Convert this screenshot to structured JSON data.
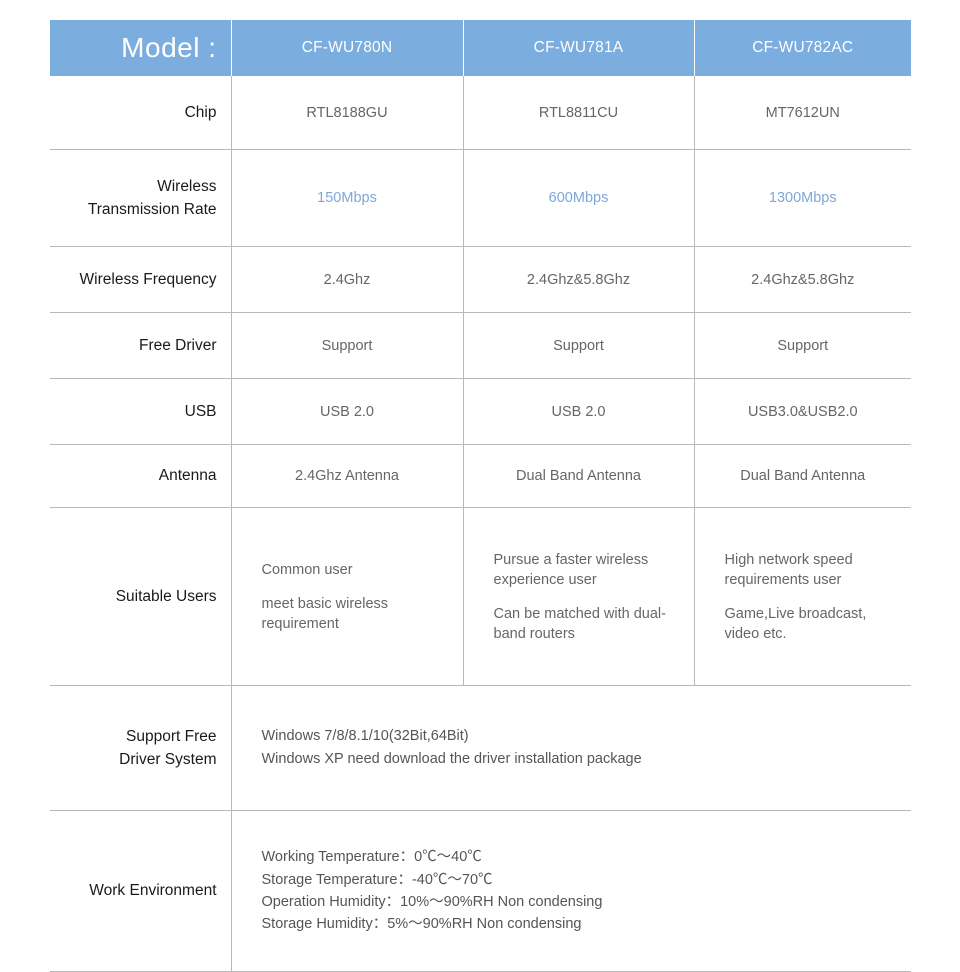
{
  "table": {
    "header": {
      "model_label": "Model :",
      "models": [
        "CF-WU780N",
        "CF-WU781A",
        "CF-WU782AC"
      ]
    },
    "colors": {
      "header_blue": "#7badde",
      "rate_blue": "#7da7d9",
      "body_text": "#666666",
      "label_text": "#1a1a1a",
      "border": "#b8b8b8"
    },
    "rows": [
      {
        "label": "Chip",
        "values": [
          "RTL8188GU",
          "RTL8811CU",
          "MT7612UN"
        ]
      },
      {
        "label": "Wireless\nTransmission Rate",
        "values": [
          "150Mbps",
          "600Mbps",
          "1300Mbps"
        ]
      },
      {
        "label": "Wireless Frequency",
        "values": [
          "2.4Ghz",
          "2.4Ghz&5.8Ghz",
          "2.4Ghz&5.8Ghz"
        ]
      },
      {
        "label": "Free Driver",
        "values": [
          "Support",
          "Support",
          "Support"
        ]
      },
      {
        "label": "USB",
        "values": [
          "USB 2.0",
          "USB 2.0",
          "USB3.0&USB2.0"
        ]
      },
      {
        "label": "Antenna",
        "values": [
          "2.4Ghz Antenna",
          "Dual Band Antenna",
          "Dual Band Antenna"
        ]
      }
    ],
    "suitable_users": {
      "label": "Suitable Users",
      "columns": [
        [
          "Common user",
          "meet basic wireless requirement"
        ],
        [
          "Pursue a faster wireless experience user",
          "Can be matched with dual-band routers"
        ],
        [
          "High network speed requirements user",
          "Game,Live broadcast, video etc."
        ]
      ]
    },
    "support_free_driver_system": {
      "label": "Support Free\nDriver System",
      "lines": [
        "Windows 7/8/8.1/10(32Bit,64Bit)",
        "Windows XP need download the driver installation package"
      ]
    },
    "work_environment": {
      "label": "Work Environment",
      "lines": [
        "Working Temperature：0℃〜40℃",
        "Storage Temperature：-40℃〜70℃",
        "Operation Humidity：10%〜90%RH Non condensing",
        "Storage Humidity：5%〜90%RH Non condensing"
      ]
    }
  }
}
